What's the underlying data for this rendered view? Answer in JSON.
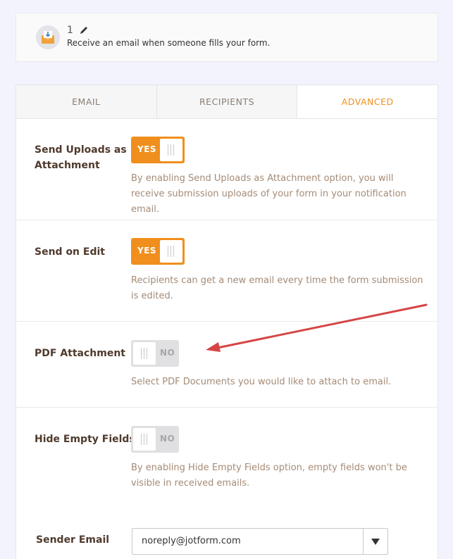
{
  "notification_card": {
    "number": "1",
    "description": "Receive an email when someone fills your form."
  },
  "tabs": [
    {
      "label": "EMAIL",
      "active": false
    },
    {
      "label": "RECIPIENTS",
      "active": false
    },
    {
      "label": "ADVANCED",
      "active": true
    }
  ],
  "settings": {
    "send_uploads": {
      "label": "Send Uploads as Attachment",
      "toggle": "YES",
      "description": "By enabling Send Uploads as Attachment option, you will receive submission uploads of your form in your notification email."
    },
    "send_on_edit": {
      "label": "Send on Edit",
      "toggle": "YES",
      "description": "Recipients can get a new email every time the form submission is edited."
    },
    "pdf_attachment": {
      "label": "PDF Attachment",
      "toggle": "NO",
      "description": "Select PDF Documents you would like to attach to email."
    },
    "hide_empty_fields": {
      "label": "Hide Empty Fields",
      "toggle": "NO",
      "description": "By enabling Hide Empty Fields option, empty fields won't be visible in received emails."
    }
  },
  "sender_email": {
    "label": "Sender Email",
    "value": "noreply@jotform.com"
  },
  "colors": {
    "accent": "#f08f1d",
    "annotation_arrow": "#d64545"
  }
}
